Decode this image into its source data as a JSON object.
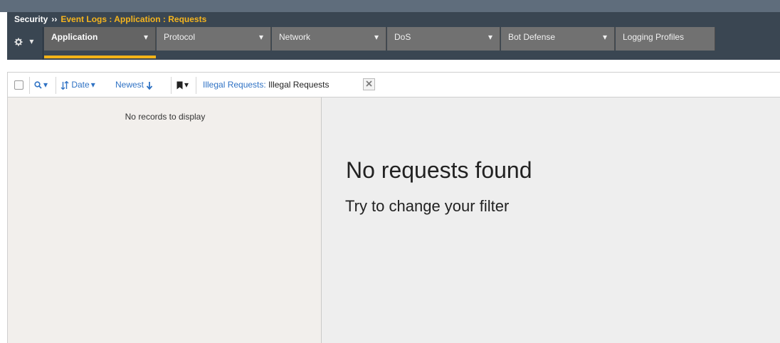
{
  "breadcrumb": {
    "root": "Security",
    "separator": "››",
    "path": "Event Logs : Application : Requests"
  },
  "tabs": {
    "gear_icon": "gear-icon",
    "items": [
      {
        "label": "Application",
        "active": true
      },
      {
        "label": "Protocol"
      },
      {
        "label": "Network"
      },
      {
        "label": "DoS"
      },
      {
        "label": "Bot Defense"
      },
      {
        "label": "Logging Profiles"
      }
    ],
    "caret": "▾"
  },
  "toolbar": {
    "sort_field": "Date",
    "sort_order": "Newest",
    "filter_label": "Illegal Requests:",
    "filter_value": "Illegal Requests"
  },
  "left_pane": {
    "empty_text": "No records to display"
  },
  "main": {
    "title": "No requests found",
    "subtitle": "Try to change your filter"
  },
  "colors": {
    "accent": "#f2b318",
    "link": "#2f72c4",
    "header_bg": "#3a4652",
    "tab_bg": "#717171"
  }
}
